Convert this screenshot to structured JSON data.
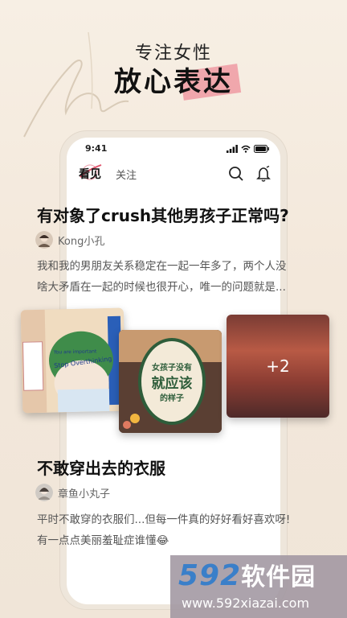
{
  "tagline": {
    "line1": "专注女性",
    "line2": "放心表达",
    "script_text": "her"
  },
  "status_bar": {
    "time": "9:41"
  },
  "tabs": [
    {
      "label": "看见"
    },
    {
      "label": "关注"
    }
  ],
  "posts": [
    {
      "title": "有对象了crush其他男孩子正常吗?",
      "author": "Kong小孔",
      "body_lines": [
        "我和我的男朋友关系稳定在一起一年多了，两个人没",
        "啥大矛盾在一起的时候也很开心，唯一的问题就是..."
      ],
      "images": {
        "img1_texts": [
          "You are important",
          "Stop Overthinking"
        ],
        "img2_texts": [
          "女孩子没有",
          "就应该",
          "的样子"
        ],
        "more": "+2"
      }
    },
    {
      "title": "不敢穿出去的衣服",
      "author": "章鱼小丸子",
      "body_lines": [
        "平时不敢穿的衣服们...但每一件真的好好看好喜欢呀!",
        "有一点点美丽羞耻症谁懂😂"
      ]
    }
  ],
  "watermark": {
    "logo_num": "592",
    "logo_cn": "软件园",
    "url": "www.592xiazai.com"
  },
  "colors": {
    "accent_pink": "#eb6e82",
    "background": "#f5ece0"
  }
}
